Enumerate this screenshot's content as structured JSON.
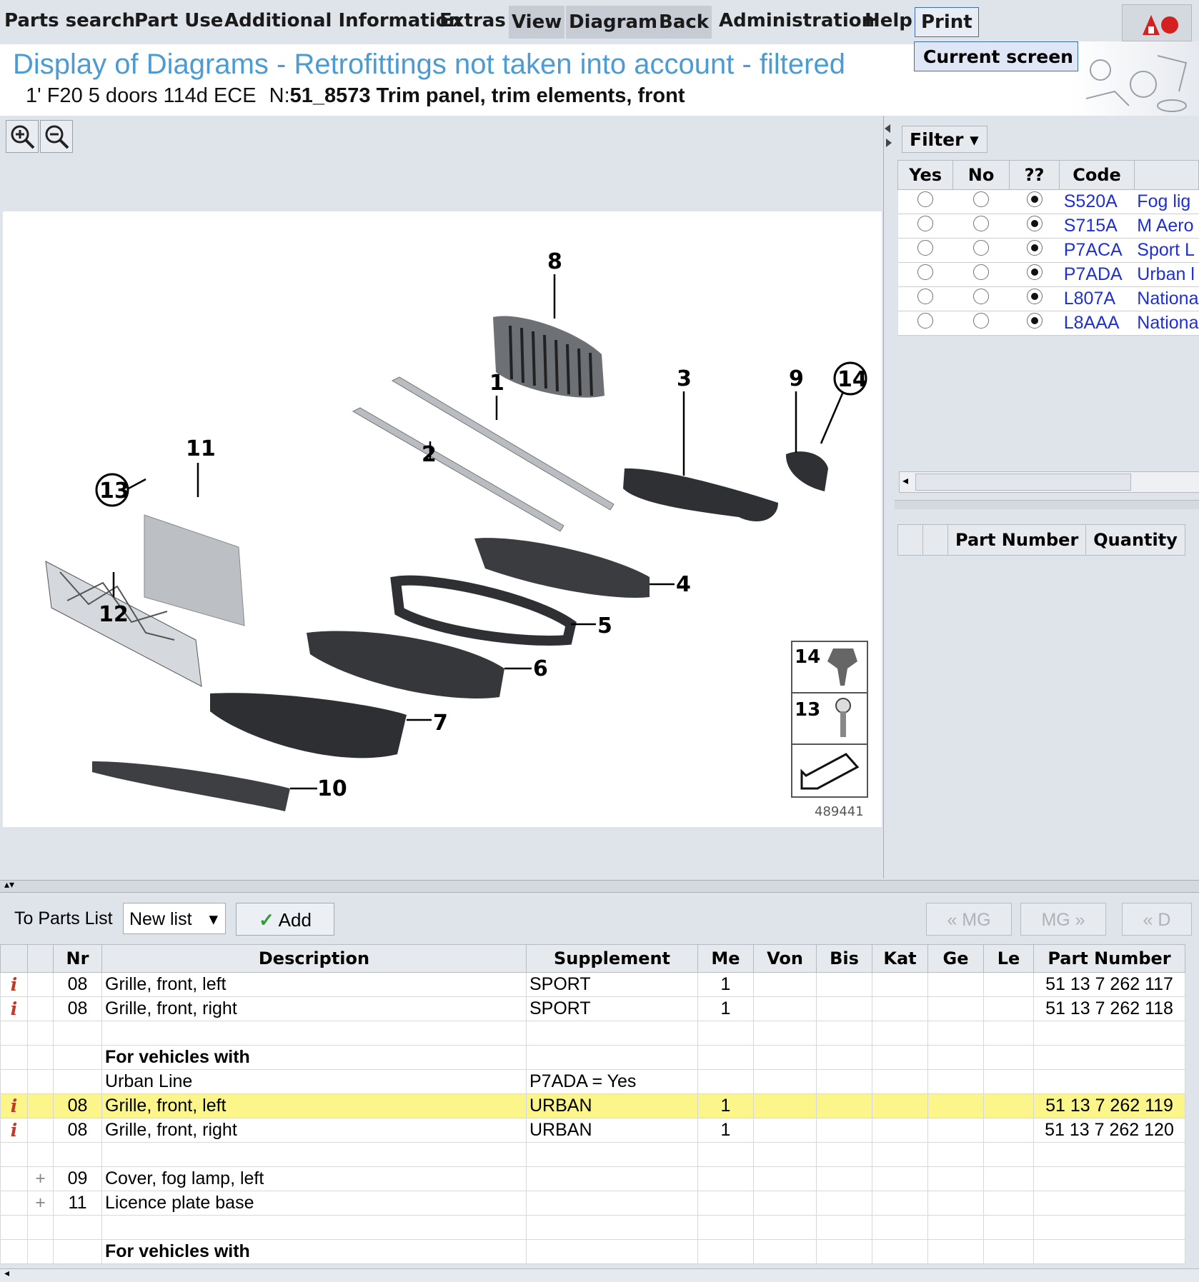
{
  "menu": {
    "items": [
      "Parts search",
      "Part Use",
      "Additional Information",
      "Extras",
      "View",
      "Diagram",
      "Back",
      "Administration",
      "Help"
    ],
    "print": "Print",
    "dropdown_item": "Current screen"
  },
  "header": {
    "title": "Display of Diagrams - Retrofittings not taken into account - filtered",
    "vehicle": "1' F20 5 doors 114d ECE",
    "group_prefix": "N:",
    "group": "51_8573 Trim panel, trim elements, front"
  },
  "diagram": {
    "callouts": [
      "8",
      "1",
      "3",
      "9",
      "14",
      "2",
      "11",
      "13",
      "4",
      "5",
      "12",
      "6",
      "7",
      "10"
    ],
    "legend": [
      "14",
      "13"
    ],
    "image_number": "489441"
  },
  "filter": {
    "button": "Filter",
    "headers": [
      "Yes",
      "No",
      "??",
      "Code",
      ""
    ],
    "rows": [
      {
        "code": "S520A",
        "desc": "Fog lig"
      },
      {
        "code": "S715A",
        "desc": "M Aero"
      },
      {
        "code": "P7ACA",
        "desc": "Sport L"
      },
      {
        "code": "P7ADA",
        "desc": "Urban l"
      },
      {
        "code": "L807A",
        "desc": "Nationa"
      },
      {
        "code": "L8AAA",
        "desc": "Nationa"
      }
    ]
  },
  "parts_list_panel": {
    "headers": [
      "",
      "",
      "Part Number",
      "Quantity"
    ]
  },
  "toolbar": {
    "to_parts_list": "To Parts List",
    "list_select": "New list",
    "add": "Add",
    "nav_prev_mg": "« MG",
    "nav_next_mg": "MG »",
    "nav_prev_d": "« D"
  },
  "table": {
    "headers": [
      "",
      "",
      "Nr",
      "Description",
      "Supplement",
      "Me",
      "Von",
      "Bis",
      "Kat",
      "Ge",
      "Le",
      "Part Number"
    ],
    "rows": [
      {
        "icon": "i",
        "plus": "",
        "nr": "08",
        "desc": "Grille, front, left",
        "supp": "SPORT",
        "me": "1",
        "pn": "51 13 7 262 117"
      },
      {
        "icon": "i",
        "plus": "",
        "nr": "08",
        "desc": "Grille, front, right",
        "supp": "SPORT",
        "me": "1",
        "pn": "51 13 7 262 118"
      },
      {
        "icon": "",
        "plus": "",
        "nr": "",
        "desc": "",
        "supp": "",
        "me": "",
        "pn": ""
      },
      {
        "icon": "",
        "plus": "",
        "nr": "",
        "desc": "For vehicles with",
        "supp": "",
        "me": "",
        "pn": "",
        "bold": true
      },
      {
        "icon": "",
        "plus": "",
        "nr": "",
        "desc": "Urban Line",
        "supp": "P7ADA = Yes",
        "me": "",
        "pn": ""
      },
      {
        "icon": "i",
        "plus": "",
        "nr": "08",
        "desc": "Grille, front, left",
        "supp": "URBAN",
        "me": "1",
        "pn": "51 13 7 262 119",
        "highlight": true
      },
      {
        "icon": "i",
        "plus": "",
        "nr": "08",
        "desc": "Grille, front, right",
        "supp": "URBAN",
        "me": "1",
        "pn": "51 13 7 262 120"
      },
      {
        "icon": "",
        "plus": "",
        "nr": "",
        "desc": "",
        "supp": "",
        "me": "",
        "pn": ""
      },
      {
        "icon": "",
        "plus": "+",
        "nr": "09",
        "desc": "Cover, fog lamp, left",
        "supp": "",
        "me": "",
        "pn": ""
      },
      {
        "icon": "",
        "plus": "+",
        "nr": "11",
        "desc": "Licence plate base",
        "supp": "",
        "me": "",
        "pn": ""
      },
      {
        "icon": "",
        "plus": "",
        "nr": "",
        "desc": "",
        "supp": "",
        "me": "",
        "pn": ""
      },
      {
        "icon": "",
        "plus": "",
        "nr": "",
        "desc": "For vehicles with",
        "supp": "",
        "me": "",
        "pn": "",
        "bold": true
      }
    ]
  }
}
